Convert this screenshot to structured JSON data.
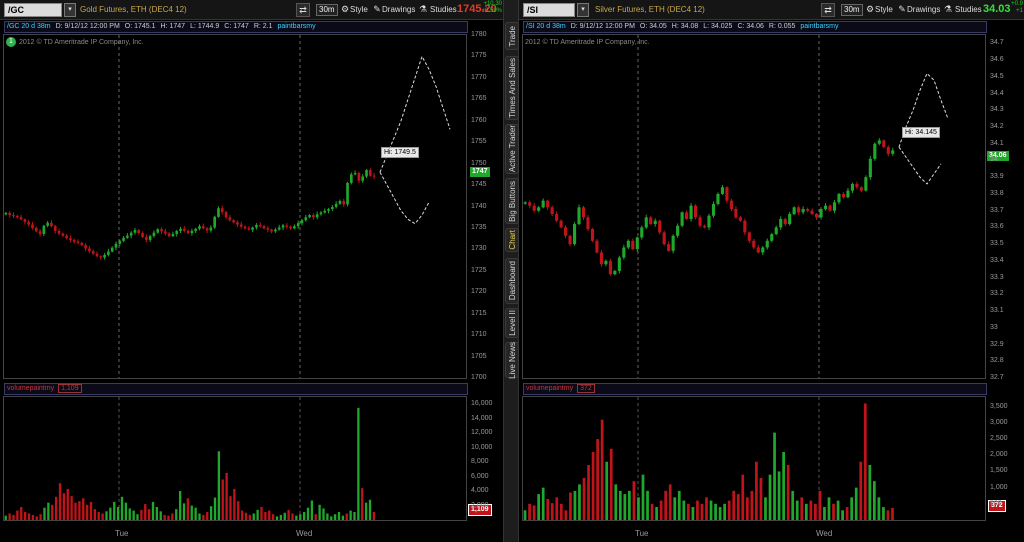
{
  "colors": {
    "up": "#1fa82b",
    "down": "#c0141a",
    "bg": "#000000",
    "accent_price_down": "#e33b2a",
    "accent_price_up": "#35e13a"
  },
  "side_tabs": [
    {
      "label": "Trade"
    },
    {
      "label": "Times And Sales"
    },
    {
      "label": "Active Trader"
    },
    {
      "label": "Big Buttons"
    },
    {
      "label": "Chart"
    },
    {
      "label": "Dashboard"
    },
    {
      "label": "Level II"
    },
    {
      "label": "Live News"
    }
  ],
  "left": {
    "symbol": "/GC",
    "description": "Gold Futures, ETH (DEC4 12)",
    "aggregation": "30m",
    "style_label": "Style",
    "drawings_label": "Drawings",
    "studies_label": "Studies",
    "price": "1745.20",
    "change_top": "+10.30",
    "change_bottom": "+0.59%",
    "info": {
      "period": "/GC 20 d 38m",
      "date": "D: 9/12/12 12:00 PM",
      "open": "O: 1745.1",
      "high": "H: 1747",
      "low": "L: 1744.9",
      "close": "C: 1747",
      "range": "R: 2.1",
      "study": "paintbarsmy"
    },
    "copyright": "2012 © TD Ameritrade IP Company, Inc.",
    "marker": "1",
    "hi_label": "Hi: 1749.5",
    "last_tag": "1747",
    "y_ticks": [
      "1780",
      "1775",
      "1770",
      "1765",
      "1760",
      "1755",
      "1750",
      "1745",
      "1740",
      "1735",
      "1730",
      "1725",
      "1720",
      "1715",
      "1710",
      "1705",
      "1700"
    ],
    "vol_ticks": [
      "16,000",
      "14,000",
      "12,000",
      "10,000",
      "8,000",
      "6,000",
      "4,000",
      "2,000"
    ],
    "vol_study": "volumepaintmy",
    "vol_value": "1,109",
    "vol_tag": "1,109",
    "x_ticks": [
      "Tue",
      "Wed"
    ]
  },
  "right": {
    "symbol": "/SI",
    "description": "Silver Futures, ETH (DEC4 12)",
    "aggregation": "30m",
    "style_label": "Style",
    "drawings_label": "Drawings",
    "studies_label": "Studies",
    "price": "34.03",
    "change_top": "+0.9",
    "change_bottom": "+1",
    "info": {
      "period": "/SI 20 d 38m",
      "date": "D: 9/12/12 12:00 PM",
      "open": "O: 34.05",
      "high": "H: 34.08",
      "low": "L: 34.025",
      "close": "C: 34.06",
      "range": "R: 0.055",
      "study": "paintbarsmy"
    },
    "copyright": "2012 © TD Ameritrade IP Company, Inc.",
    "hi_label": "Hi: 34.145",
    "last_tag": "34.06",
    "y_ticks": [
      "34.7",
      "34.6",
      "34.5",
      "34.4",
      "34.3",
      "34.2",
      "34.1",
      "34",
      "33.9",
      "33.8",
      "33.7",
      "33.6",
      "33.5",
      "33.4",
      "33.3",
      "33.2",
      "33.1",
      "33",
      "32.9",
      "32.8",
      "32.7"
    ],
    "vol_ticks": [
      "3,500",
      "3,000",
      "2,500",
      "2,000",
      "1,500",
      "1,000",
      "500"
    ],
    "vol_study": "volumepaintmy",
    "vol_value": "372",
    "vol_tag": "372",
    "x_ticks": [
      "Tue",
      "Wed"
    ]
  },
  "chart_data": [
    {
      "type": "candlestick",
      "title": "/GC 30m",
      "ylim": [
        1700,
        1780
      ],
      "y_axis_side": "right",
      "closes": [
        1738.5,
        1738,
        1737.8,
        1737.5,
        1737,
        1736.4,
        1735.8,
        1735,
        1734.2,
        1733.6,
        1735.5,
        1736.2,
        1735.4,
        1734.3,
        1733.7,
        1733.2,
        1732.6,
        1732.2,
        1731.8,
        1731.5,
        1731,
        1730.2,
        1729.6,
        1729,
        1728.4,
        1728.1,
        1728.7,
        1729.5,
        1730.4,
        1731.3,
        1732,
        1732.7,
        1733.2,
        1733.9,
        1734.5,
        1733.8,
        1732.9,
        1732.2,
        1733.1,
        1733.9,
        1734.7,
        1734.2,
        1733.7,
        1733.1,
        1733.6,
        1734.3,
        1734.8,
        1734.3,
        1733.8,
        1734.3,
        1734.8,
        1735.4,
        1734.9,
        1734.4,
        1735.1,
        1737.6,
        1739.6,
        1738.7,
        1737.5,
        1736.8,
        1736.3,
        1735.8,
        1735.3,
        1734.9,
        1734.6,
        1735.1,
        1735.7,
        1735.4,
        1734.9,
        1734.6,
        1734.2,
        1734.6,
        1735.1,
        1735.6,
        1735.3,
        1734.9,
        1735.4,
        1736.1,
        1736.8,
        1737.5,
        1738,
        1737.5,
        1738.2,
        1738.6,
        1739,
        1739.4,
        1739.9,
        1740.6,
        1741.3,
        1740.5,
        1745.5,
        1747.5,
        1747.8,
        1746,
        1747,
        1748.5,
        1747.2,
        1747
      ],
      "projection_upper": [
        1748,
        1752,
        1756,
        1760,
        1765,
        1770,
        1775,
        1772,
        1768,
        1763,
        1758
      ],
      "projection_lower": [
        1748,
        1745,
        1742,
        1739,
        1737,
        1736,
        1738,
        1741
      ],
      "hi_value": 1749.5,
      "last": 1747,
      "volume": {
        "ylim": [
          0,
          17000
        ],
        "values": [
          600,
          900,
          700,
          1300,
          1800,
          1100,
          900,
          700,
          500,
          800,
          1700,
          2400,
          2100,
          3200,
          5100,
          3700,
          4300,
          3300,
          2400,
          2600,
          3000,
          2100,
          2500,
          1500,
          1100,
          900,
          1200,
          1700,
          2500,
          1800,
          3200,
          2400,
          1600,
          1300,
          800,
          1400,
          2200,
          1500,
          2500,
          1800,
          1200,
          700,
          600,
          900,
          1500,
          4000,
          2300,
          3000,
          2000,
          1700,
          900,
          700,
          1100,
          1900,
          3100,
          9500,
          5600,
          6500,
          3300,
          4300,
          2600,
          1300,
          1000,
          700,
          900,
          1400,
          1800,
          1100,
          1300,
          800,
          500,
          700,
          1000,
          1400,
          900,
          600,
          800,
          1100,
          1700,
          2700,
          800,
          2100,
          1600,
          900,
          500,
          800,
          1100,
          600,
          900,
          1300,
          1100,
          15500,
          4400,
          2400,
          2800,
          1109
        ]
      }
    },
    {
      "type": "candlestick",
      "title": "/SI 30m",
      "ylim": [
        32.7,
        34.75
      ],
      "y_axis_side": "right",
      "closes": [
        33.75,
        33.73,
        33.7,
        33.72,
        33.76,
        33.72,
        33.68,
        33.64,
        33.6,
        33.55,
        33.5,
        33.62,
        33.72,
        33.66,
        33.59,
        33.52,
        33.45,
        33.38,
        33.4,
        33.32,
        33.34,
        33.42,
        33.48,
        33.52,
        33.47,
        33.54,
        33.6,
        33.66,
        33.62,
        33.64,
        33.57,
        33.5,
        33.46,
        33.55,
        33.61,
        33.69,
        33.65,
        33.73,
        33.66,
        33.61,
        33.6,
        33.67,
        33.74,
        33.8,
        33.84,
        33.76,
        33.71,
        33.66,
        33.64,
        33.57,
        33.52,
        33.48,
        33.45,
        33.48,
        33.52,
        33.56,
        33.6,
        33.65,
        33.62,
        33.68,
        33.72,
        33.69,
        33.71,
        33.7,
        33.68,
        33.66,
        33.71,
        33.73,
        33.7,
        33.75,
        33.8,
        33.78,
        33.82,
        33.86,
        33.84,
        33.82,
        33.9,
        34.01,
        34.1,
        34.12,
        34.08,
        34.04,
        34.06
      ],
      "projection_upper": [
        34.08,
        34.2,
        34.3,
        34.42,
        34.52,
        34.48,
        34.36,
        34.25
      ],
      "projection_lower": [
        34.08,
        34.02,
        33.96,
        33.9,
        33.86,
        33.92,
        33.98
      ],
      "hi_value": 34.145,
      "last": 34.06,
      "volume": {
        "ylim": [
          0,
          3800
        ],
        "values": [
          300,
          500,
          450,
          800,
          1000,
          650,
          520,
          700,
          500,
          300,
          850,
          900,
          1100,
          1300,
          1700,
          2100,
          2500,
          3100,
          1800,
          2200,
          1100,
          900,
          800,
          900,
          1200,
          700,
          1400,
          900,
          500,
          400,
          600,
          900,
          1100,
          700,
          900,
          600,
          500,
          400,
          600,
          500,
          700,
          600,
          500,
          400,
          500,
          600,
          900,
          800,
          1400,
          700,
          900,
          1800,
          1300,
          700,
          1400,
          2700,
          1500,
          2100,
          1700,
          900,
          600,
          700,
          500,
          600,
          500,
          900,
          400,
          700,
          500,
          600,
          300,
          400,
          700,
          1000,
          1800,
          3600,
          1700,
          1200,
          700,
          400,
          300,
          372
        ]
      }
    }
  ]
}
